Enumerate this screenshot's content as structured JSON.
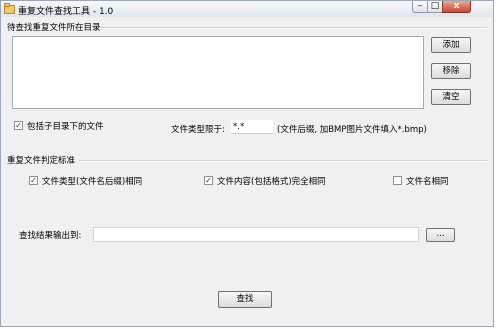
{
  "window": {
    "title": "重复文件查找工具 - 1.0"
  },
  "controls": {
    "minimize": "–",
    "maximize": "□",
    "close": "x"
  },
  "directory_section": {
    "label": "待查找重复文件所在目录"
  },
  "buttons": {
    "add": "添加",
    "remove": "移除",
    "clear": "清空",
    "browse": "...",
    "search": "查找"
  },
  "include_subdirs": {
    "label": "包括子目录下的文件",
    "checked": true
  },
  "file_type": {
    "label": "文件类型限于:",
    "value": "*.*",
    "hint": "(文件后缀, 加BMP图片文件填入*.bmp)"
  },
  "criteria": {
    "label": "重复文件判定标准",
    "file_type_same": {
      "label": "文件类型(文件名后缀)相同",
      "checked": true
    },
    "content_same": {
      "label": "文件内容(包括格式)完全相同",
      "checked": true
    },
    "name_same": {
      "label": "文件名相同",
      "checked": false
    }
  },
  "output": {
    "label": "查找结果输出到:",
    "value": ""
  },
  "check_mark": "✓"
}
